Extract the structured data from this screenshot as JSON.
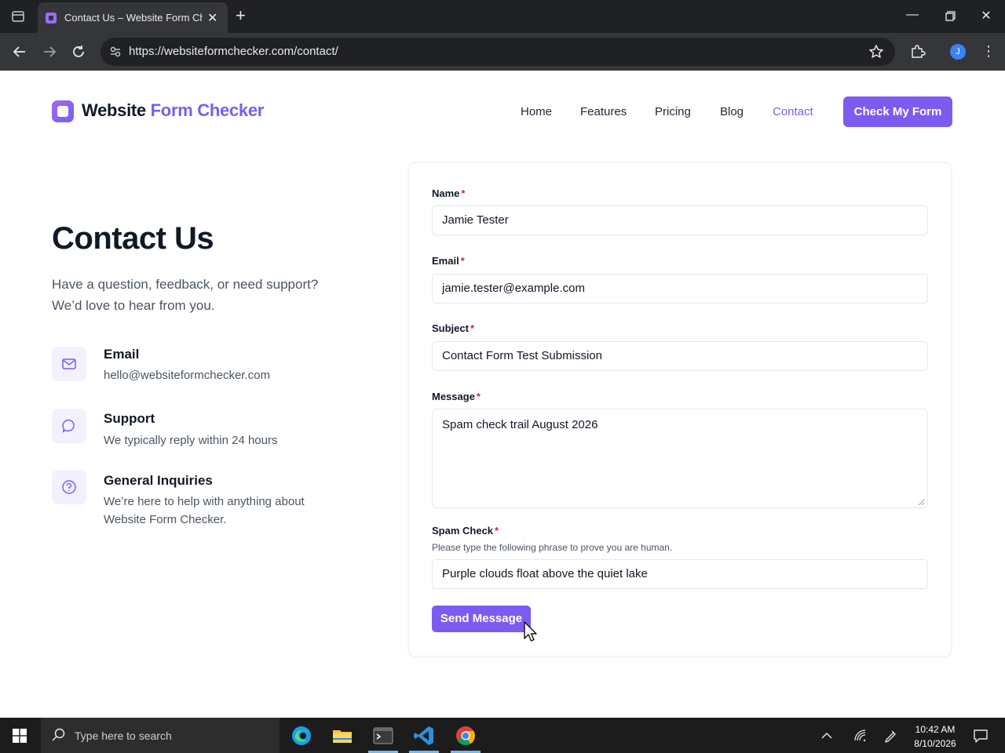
{
  "browser": {
    "tab_title": "Contact Us – Website Form Chec",
    "url": "https://websiteformchecker.com/contact/",
    "profile_initial": "J"
  },
  "site": {
    "logo_word1": "Website",
    "logo_word2": "Form Checker",
    "nav": [
      "Home",
      "Features",
      "Pricing",
      "Blog",
      "Contact"
    ],
    "active_nav": "Contact",
    "cta_label": "Check My Form"
  },
  "intro": {
    "title": "Contact Us",
    "lead": "Have a question, feedback, or need support? We’d love to hear from you.",
    "items": [
      {
        "icon": "mail-icon",
        "title": "Email",
        "text": "hello@websiteformchecker.com"
      },
      {
        "icon": "chat-bubble-icon",
        "title": "Support",
        "text": "We typically reply within 24 hours"
      },
      {
        "icon": "help-circle-icon",
        "title": "General Inquiries",
        "text": "We’re here to help with anything about Website Form Checker."
      }
    ]
  },
  "form": {
    "name_label": "Name",
    "name_value": "Jamie Tester",
    "email_label": "Email",
    "email_value": "jamie.tester@example.com",
    "subject_label": "Subject",
    "subject_value": "Contact Form Test Submission",
    "message_label": "Message",
    "message_value": "Spam check trail August 2026",
    "spam_label": "Spam Check",
    "spam_help": "Please type the following phrase to prove you are human.",
    "spam_value": "Purple clouds float above the quiet lake",
    "required_mark": "*",
    "submit_label": "Send Message"
  },
  "taskbar": {
    "search_placeholder": "Type here to search",
    "time": "10:42 AM",
    "date": "8/10/2026"
  },
  "colors": {
    "accent": "#7c5cf0",
    "required": "#e11d48"
  }
}
